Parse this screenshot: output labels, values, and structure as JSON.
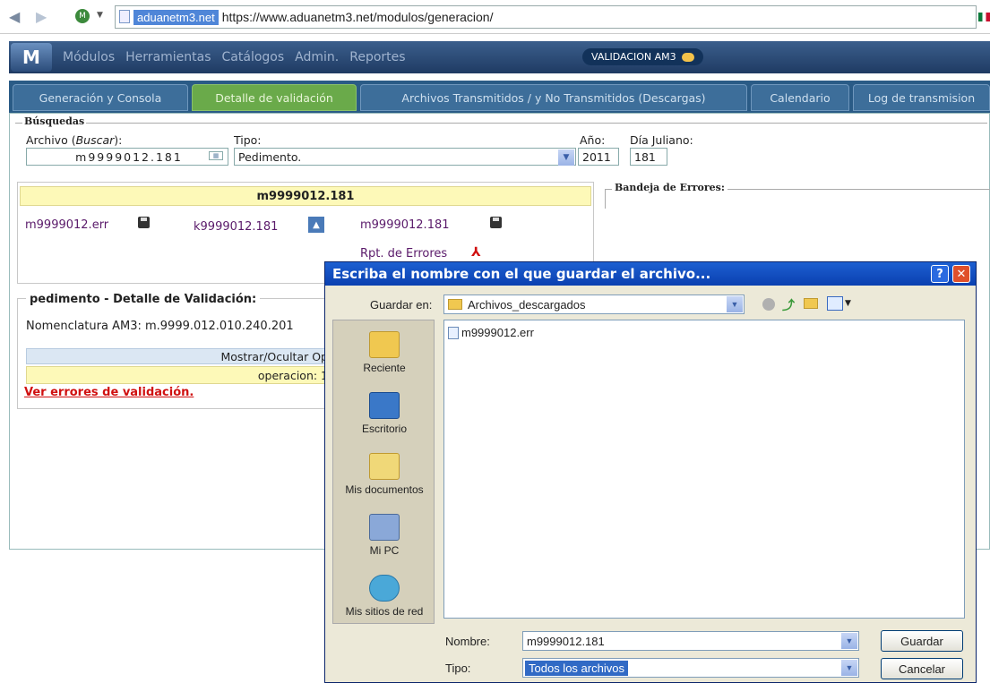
{
  "browser": {
    "site_badge": "aduanetm3.net",
    "url": "https://www.aduanetm3.net/modulos/generacion/"
  },
  "topnav": {
    "logo": "M",
    "menu": [
      "Módulos",
      "Herramientas",
      "Catálogos",
      "Admin.",
      "Reportes"
    ],
    "badge": "VALIDACION AM3"
  },
  "tabs": [
    "Generación y Consola",
    "Detalle de validación",
    "Archivos Transmitidos / y No Transmitidos (Descargas)",
    "Calendario",
    "Log de transmision"
  ],
  "busquedas": {
    "legend": "Búsquedas",
    "archivo_label": "Archivo (",
    "archivo_link": "Buscar",
    "archivo_close": "):",
    "archivo_value": "m9999012.181",
    "tipo_label": "Tipo:",
    "tipo_value": "Pedimento.",
    "anio_label": "Año:",
    "anio_value": "2011",
    "dia_label": "Día Juliano:",
    "dia_value": "181"
  },
  "files_panel": {
    "header": "m9999012.181",
    "err_file": "m9999012.err",
    "k_file": "k9999012.181",
    "m_file": "m9999012.181",
    "report": "Rpt. de Errores"
  },
  "bandeja": {
    "legend": "Bandeja de Errores:"
  },
  "detalle": {
    "legend": "pedimento - Detalle de Validación:",
    "nomenclatura": "Nomenclatura AM3: m.9999.012.010.240.201",
    "toggle": "Mostrar/Ocultar Op",
    "operacion": "operacion: 1",
    "link": "Ver errores de validación."
  },
  "dialog": {
    "title": "Escriba el nombre con el que guardar el archivo...",
    "guardar_en_label": "Guardar en:",
    "folder": "Archivos_descargados",
    "places": [
      "Reciente",
      "Escritorio",
      "Mis documentos",
      "Mi PC",
      "Mis sitios de red"
    ],
    "files": [
      "m9999012.err"
    ],
    "nombre_label": "Nombre:",
    "nombre_value": "m9999012.181",
    "tipo_label": "Tipo:",
    "tipo_value": "Todos los archivos",
    "save_button": "Guardar",
    "cancel_button": "Cancelar"
  }
}
